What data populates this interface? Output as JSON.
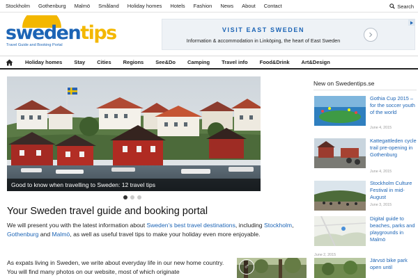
{
  "topnav": {
    "items": [
      "Stockholm",
      "Gothenburg",
      "Malmö",
      "Småland",
      "Holiday homes",
      "Hotels",
      "Fashion",
      "News",
      "About",
      "Contact"
    ],
    "search_label": "Search"
  },
  "logo": {
    "text_a": "sweden",
    "text_b": "tips",
    "tagline": "Travel Guide and Booking Portal"
  },
  "ad": {
    "title": "VISIT EAST SWEDEN",
    "subtitle": "Information & accommodation in Linköping, the heart of East Sweden"
  },
  "mainnav": {
    "items": [
      "Holiday homes",
      "Stay",
      "Cities",
      "Regions",
      "See&Do",
      "Camping",
      "Travel info",
      "Food&Drink",
      "Art&Design"
    ]
  },
  "slider": {
    "caption": "Good to know when travelling to Sweden: 12 travel tips",
    "slide_count": 3,
    "active_index": 0
  },
  "main": {
    "headline": "Your Sweden travel guide and booking portal",
    "intro_1": "We will present you with the latest information about ",
    "intro_link_1": "Sweden’s best travel destinations",
    "intro_2": ", including ",
    "intro_link_2": "Stockholm",
    "intro_3": ", ",
    "intro_link_3": "Gothenburg",
    "intro_4": " and ",
    "intro_link_4": "Malmö",
    "intro_5": ", as well as useful travel tips to make your holiday even more enjoyable.",
    "body_2": "As expats living in Sweden, we write about everyday life in our new home country. You will find many photos on our website, most of which originate"
  },
  "sidebar": {
    "title": "New on Swedentips.se",
    "news": [
      {
        "title": "Gothia Cup 2015 – for the soccer youth of the world",
        "date": "June 4, 2015"
      },
      {
        "title": "Kattegattleden cycle trail pre-opening in Gothenburg",
        "date": "June 4, 2015"
      },
      {
        "title": "Stockholm Culture Festival in mid-August",
        "date": "June 3, 2015"
      },
      {
        "title": "Digital guide to beaches, parks and playgrounds in Malmö",
        "date": "June 2, 2015"
      },
      {
        "title": "Järvsö bike park open until",
        "date": ""
      }
    ]
  },
  "colors": {
    "accent": "#1c64b5",
    "logo_yellow": "#f3b700",
    "nav_border": "#222222"
  }
}
